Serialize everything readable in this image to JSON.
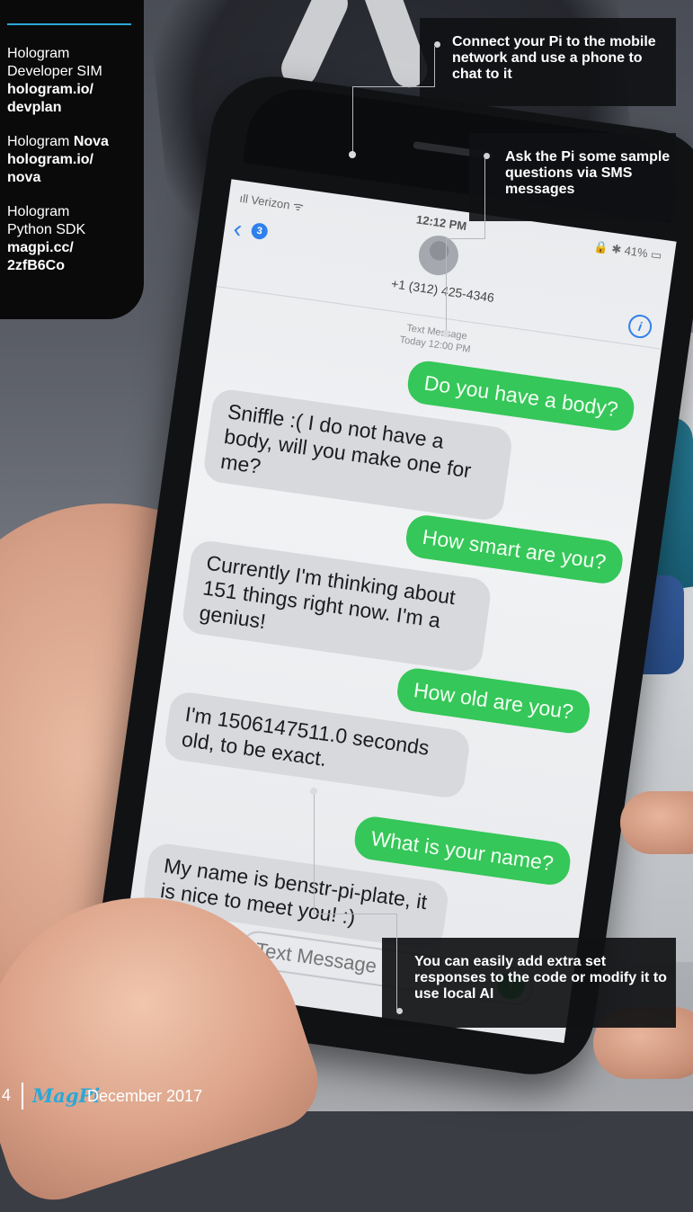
{
  "sidebar": {
    "heading": "",
    "items": [
      {
        "line1": "Hologram",
        "line2": "Developer SIM",
        "bold_inline": "",
        "link1": "hologram.io/",
        "link2": "devplan"
      },
      {
        "line1": "Hologram",
        "line2": "",
        "bold_inline": "Nova",
        "link1": "hologram.io/",
        "link2": "nova"
      },
      {
        "line1": "Hologram",
        "line2": "Python SDK",
        "bold_inline": "",
        "link1": "magpi.cc/",
        "link2": "2zfB6Co"
      }
    ]
  },
  "phone": {
    "status": {
      "carrier": "ıll Verizon ᯤ",
      "time": "12:12 PM",
      "battery": "🔒 ✱ 41% ▭"
    },
    "back_badge": "3",
    "contact_number": "+1 (312) 425-4346",
    "info_label": "i",
    "thread_label": "Text Message",
    "thread_time": "Today 12:00 PM",
    "messages": [
      {
        "dir": "out",
        "text": "Do you have a body?"
      },
      {
        "dir": "in",
        "text": "Sniffle :( I do not have a body, will you make one for me?"
      },
      {
        "dir": "out",
        "text": "How smart are you?"
      },
      {
        "dir": "in",
        "text": "Currently I'm thinking about 151 things right now. I'm a genius!"
      },
      {
        "dir": "out",
        "text": "How old are you?"
      },
      {
        "dir": "in",
        "text": "I'm 1506147511.0 seconds old, to be exact."
      },
      {
        "dir": "out",
        "text": "What is your name?"
      },
      {
        "dir": "in",
        "text": "My name is benstr-pi-plate, it is nice to meet you! :)"
      }
    ],
    "compose_placeholder": "Text Message",
    "send_glyph": "↑",
    "appstore_glyph": "A",
    "icons": [
      "camera-icon",
      "app-store-icon",
      "send-icon",
      "info-icon",
      "back-chevron-icon",
      "avatar-icon"
    ]
  },
  "callouts": [
    {
      "text": "Connect your Pi to the mobile network and use a phone to chat to it"
    },
    {
      "text": "Ask the Pi some sample questions via SMS messages"
    },
    {
      "text": "You can easily add extra set responses to the code or modify it to use local AI"
    }
  ],
  "footer": {
    "page": "4",
    "brand": "MagPi",
    "issue": "December 2017"
  },
  "colors": {
    "accent": "#2aa8d8",
    "imessage_green": "#35c759",
    "ios_blue": "#2f80ed",
    "callout_bg": "#101113"
  }
}
